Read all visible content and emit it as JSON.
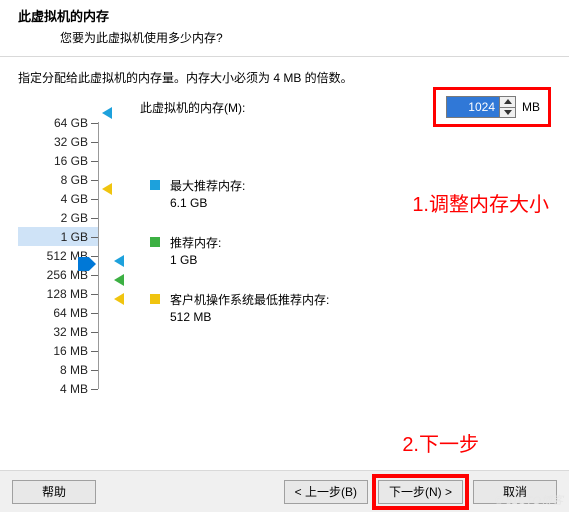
{
  "header": {
    "title": "此虚拟机的内存",
    "subtitle": "您要为此虚拟机使用多少内存?"
  },
  "instruction": "指定分配给此虚拟机的内存量。内存大小必须为 4 MB 的倍数。",
  "memory": {
    "label": "此虚拟机的内存(M):",
    "value": "1024",
    "unit": "MB"
  },
  "ruler": {
    "ticks": [
      "64 GB",
      "32 GB",
      "16 GB",
      "8 GB",
      "4 GB",
      "2 GB",
      "1 GB",
      "512 MB",
      "256 MB",
      "128 MB",
      "64 MB",
      "32 MB",
      "16 MB",
      "8 MB",
      "4 MB"
    ],
    "selected_index": 6
  },
  "legend": {
    "max": {
      "label": "最大推荐内存:",
      "value": "6.1 GB"
    },
    "rec": {
      "label": "推荐内存:",
      "value": "1 GB"
    },
    "min": {
      "label": "客户机操作系统最低推荐内存:",
      "value": "512 MB"
    }
  },
  "annotations": {
    "a1": "1.调整内存大小",
    "a2": "2.下一步"
  },
  "buttons": {
    "help": "帮助",
    "back": "< 上一步(B)",
    "next": "下一步(N) >",
    "cancel": "取消"
  },
  "watermark": "© 51CTO博客"
}
